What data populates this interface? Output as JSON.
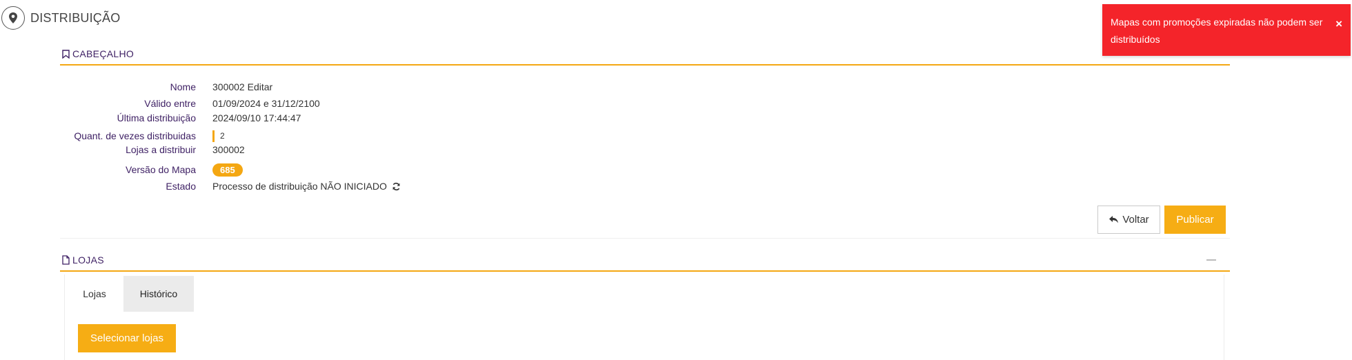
{
  "page": {
    "title": "DISTRIBUIÇÃO",
    "icon": "map-pin-icon"
  },
  "toast": {
    "message": "Mapas com promoções expiradas não podem ser distribuídos",
    "close_label": "×",
    "color": "#f4242a"
  },
  "header_section": {
    "title": "CABEÇALHO",
    "icon": "bookmark-icon",
    "fields": {
      "nome": {
        "label": "Nome",
        "value": "300002 Editar"
      },
      "valido": {
        "label": "Válido entre",
        "value": "01/09/2024 e 31/12/2100"
      },
      "ultima": {
        "label": "Última distribuição",
        "value": "2024/09/10 17:44:47"
      },
      "quant": {
        "label": "Quant. de vezes distribuidas",
        "value": "2"
      },
      "lojas": {
        "label": "Lojas a distribuir",
        "value": "300002"
      },
      "versao": {
        "label": "Versão do Mapa",
        "value": "685"
      },
      "estado": {
        "label": "Estado",
        "value": "Processo de distribuição NÃO INICIADO",
        "icon": "refresh-icon"
      }
    }
  },
  "actions": {
    "voltar_label": "Voltar",
    "voltar_icon": "reply-arrow-icon",
    "publicar_label": "Publicar"
  },
  "lojas_section": {
    "title": "LOJAS",
    "icon": "file-icon",
    "tabs": [
      {
        "label": "Lojas",
        "active": true
      },
      {
        "label": "Histórico",
        "active": false
      }
    ],
    "select_button_label": "Selecionar lojas"
  },
  "colors": {
    "accent": "#f4a712",
    "label": "#3d1f63",
    "toast": "#f4242a"
  }
}
